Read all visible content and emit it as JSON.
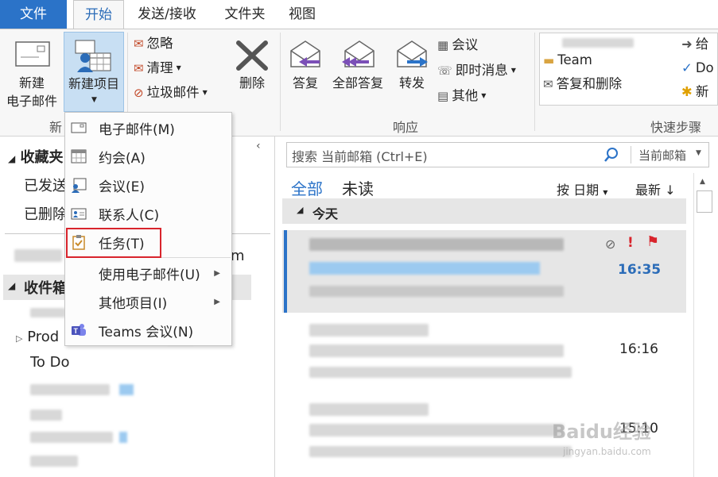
{
  "tabs": {
    "file": "文件",
    "home": "开始",
    "send_receive": "发送/接收",
    "folder": "文件夹",
    "view": "视图"
  },
  "ribbon": {
    "new_email": [
      "新建",
      "电子邮件"
    ],
    "new_items": "新建项目",
    "ignore": "忽略",
    "cleanup": "清理",
    "junk": "垃圾邮件",
    "delete": "删除",
    "reply": "答复",
    "reply_all": "全部答复",
    "forward": "转发",
    "meeting": "会议",
    "im": "即时消息",
    "more": "其他",
    "qs_team": "Team",
    "qs_reply_delete": "答复和删除",
    "qs_give": "给",
    "qs_do": "Do",
    "qs_new": "新",
    "group_new": "新",
    "group_respond": "响应",
    "group_quicksteps": "快速步骤"
  },
  "menu": {
    "items": [
      {
        "label": "电子邮件(M)"
      },
      {
        "label": "约会(A)"
      },
      {
        "label": "会议(E)"
      },
      {
        "label": "联系人(C)"
      },
      {
        "label": "任务(T)"
      },
      {
        "label": "使用电子邮件(U)"
      },
      {
        "label": "其他项目(I)"
      },
      {
        "label": "Teams 会议(N)"
      }
    ]
  },
  "left": {
    "favorites": "收藏夹",
    "sent": "已发送",
    "deleted": "已删除",
    "m_char": "m",
    "inbox": "收件箱",
    "products": "Prod",
    "todo": "To Do"
  },
  "search": {
    "placeholder": "搜索 当前邮箱 (Ctrl+E)",
    "scope": "当前邮箱"
  },
  "filters": {
    "all": "全部",
    "unread": "未读",
    "sort": "按 日期",
    "order": "最新"
  },
  "list": {
    "today": "今天",
    "times": [
      "16:35",
      "16:16",
      "15:10"
    ],
    "flag_exclaim": "!"
  },
  "watermark": {
    "brand": "Baidu经验",
    "url": "jingyan.baidu.com"
  },
  "colors": {
    "accent": "#2b73c8",
    "menu_highlight": "#d8242c",
    "selected_row": "#e6e6e6"
  }
}
